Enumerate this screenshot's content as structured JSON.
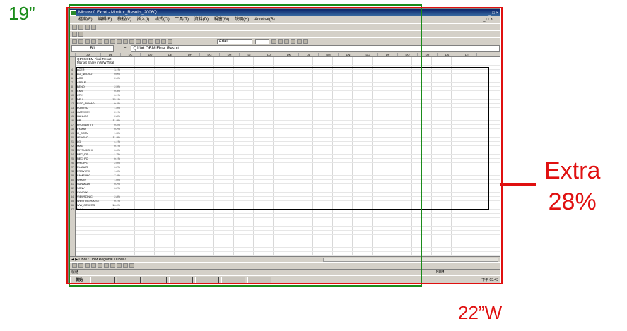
{
  "labels": {
    "left_size": "19”",
    "right_size": "22”W",
    "extra_line1": "Extra",
    "extra_line2": "28%"
  },
  "colors": {
    "green_frame": "#1a8c1a",
    "red_frame": "#e01010"
  },
  "excel": {
    "window_title": "Microsoft Excel - Monitor_Results_2006Q1",
    "menu": [
      "檔案(F)",
      "編輯(E)",
      "檢視(V)",
      "插入(I)",
      "格式(O)",
      "工具(T)",
      "資料(D)",
      "視窗(W)",
      "說明(H)",
      "Acrobat(B)"
    ],
    "font_name": "Arial",
    "name_box": "B1",
    "formula": "Q1'06 OBM Final Result",
    "sheet_title_1": "Q1'06 OBM Final Result",
    "sheet_title_2": "Market Share in WW Total",
    "sheet_tabs": "OBM / OBM Regional / OBM /",
    "status_ready": "就緒",
    "status_num": "NUM",
    "start_label": "開始",
    "clock": "下午 03:43"
  },
  "table": {
    "brands": [
      "ACER",
      "AG_NEOVO",
      "AOC",
      "APPLE",
      "BENQ",
      "CMV",
      "CTX",
      "DELL",
      "EIZO_NANAO",
      "FUJITSU",
      "GATEWAY",
      "HANNSG",
      "HP",
      "HYUNDAI_IT",
      "IIYAMA",
      "I0_DATA",
      "LENOVO",
      "LG",
      "MAG",
      "MITSUBISHI",
      "NEC_DS",
      "NEC_PC",
      "PHILIPS",
      "PLANAR",
      "PROVIEW",
      "SAMSUNG",
      "SHARP",
      "SUNMADE",
      "SONY",
      "SYNTAX",
      "VIEWSONIC",
      "WESTINGHOUSE",
      "WW_OTHERS",
      "Total"
    ],
    "sample_values": [
      "3.1%",
      "0.0%",
      "2.6%",
      "",
      "2.5%",
      "0.3%",
      "0.1%",
      "15.1%",
      "0.4%",
      "1.5%",
      "2.1%",
      "2.8%",
      "11.8%",
      "0.4%",
      "0.2%",
      "1.3%",
      "11.8%",
      "4.1%",
      "0.1%",
      "0.6%",
      "1.7%",
      "0.1%",
      "2.6%",
      "0.2%",
      "1.6%",
      "7.4%",
      "1.6%",
      "0.2%",
      "0.2%",
      "",
      "2.8%",
      "0.1%",
      "16.4%",
      "100.0%"
    ]
  }
}
